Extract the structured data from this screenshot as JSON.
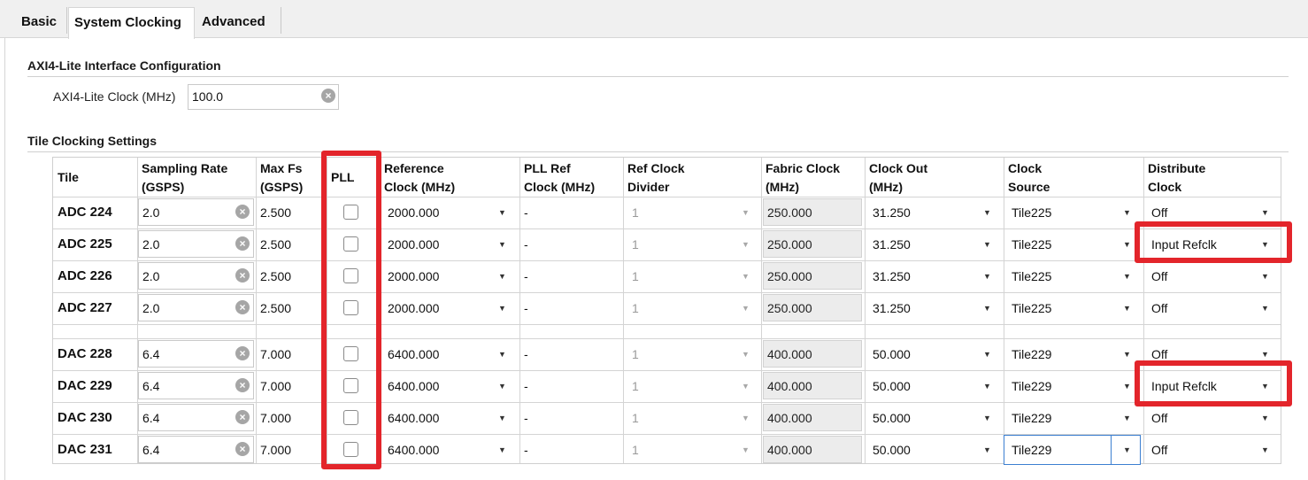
{
  "tabs": [
    {
      "label": "Basic",
      "active": false
    },
    {
      "label": "System Clocking",
      "active": true
    },
    {
      "label": "Advanced",
      "active": false
    }
  ],
  "axi": {
    "section_title": "AXI4-Lite Interface Configuration",
    "clock_label": "AXI4-Lite Clock (MHz)",
    "clock_value": "100.0"
  },
  "tile_section_title": "Tile Clocking Settings",
  "columns": [
    {
      "line1": "Tile",
      "line2": ""
    },
    {
      "line1": "Sampling Rate",
      "line2": "(GSPS)"
    },
    {
      "line1": "Max Fs",
      "line2": "(GSPS)"
    },
    {
      "line1": "PLL",
      "line2": ""
    },
    {
      "line1": "Reference",
      "line2": "Clock (MHz)"
    },
    {
      "line1": "PLL Ref",
      "line2": "Clock (MHz)"
    },
    {
      "line1": "Ref Clock",
      "line2": "Divider"
    },
    {
      "line1": "Fabric Clock",
      "line2": "(MHz)"
    },
    {
      "line1": "Clock Out",
      "line2": "(MHz)"
    },
    {
      "line1": "Clock",
      "line2": "Source"
    },
    {
      "line1": "Distribute",
      "line2": "Clock"
    }
  ],
  "rows": [
    {
      "tile": "ADC 224",
      "sampling": "2.0",
      "maxfs": "2.500",
      "pll": false,
      "ref": "2000.000",
      "pllref": "-",
      "div": "1",
      "fabric": "250.000",
      "clkout": "31.250",
      "source": "Tile225",
      "distribute": "Off"
    },
    {
      "tile": "ADC 225",
      "sampling": "2.0",
      "maxfs": "2.500",
      "pll": false,
      "ref": "2000.000",
      "pllref": "-",
      "div": "1",
      "fabric": "250.000",
      "clkout": "31.250",
      "source": "Tile225",
      "distribute": "Input Refclk"
    },
    {
      "tile": "ADC 226",
      "sampling": "2.0",
      "maxfs": "2.500",
      "pll": false,
      "ref": "2000.000",
      "pllref": "-",
      "div": "1",
      "fabric": "250.000",
      "clkout": "31.250",
      "source": "Tile225",
      "distribute": "Off"
    },
    {
      "tile": "ADC 227",
      "sampling": "2.0",
      "maxfs": "2.500",
      "pll": false,
      "ref": "2000.000",
      "pllref": "-",
      "div": "1",
      "fabric": "250.000",
      "clkout": "31.250",
      "source": "Tile225",
      "distribute": "Off"
    },
    {
      "tile": "DAC 228",
      "sampling": "6.4",
      "maxfs": "7.000",
      "pll": false,
      "ref": "6400.000",
      "pllref": "-",
      "div": "1",
      "fabric": "400.000",
      "clkout": "50.000",
      "source": "Tile229",
      "distribute": "Off"
    },
    {
      "tile": "DAC 229",
      "sampling": "6.4",
      "maxfs": "7.000",
      "pll": false,
      "ref": "6400.000",
      "pllref": "-",
      "div": "1",
      "fabric": "400.000",
      "clkout": "50.000",
      "source": "Tile229",
      "distribute": "Input Refclk"
    },
    {
      "tile": "DAC 230",
      "sampling": "6.4",
      "maxfs": "7.000",
      "pll": false,
      "ref": "6400.000",
      "pllref": "-",
      "div": "1",
      "fabric": "400.000",
      "clkout": "50.000",
      "source": "Tile229",
      "distribute": "Off"
    },
    {
      "tile": "DAC 231",
      "sampling": "6.4",
      "maxfs": "7.000",
      "pll": false,
      "ref": "6400.000",
      "pllref": "-",
      "div": "1",
      "fabric": "400.000",
      "clkout": "50.000",
      "source": "Tile229",
      "distribute": "Off"
    }
  ],
  "icons": {
    "clear": "clear-circle-icon",
    "dropdown": "chevron-down-icon"
  },
  "colors": {
    "highlight": "#e3252b",
    "focus": "#3c7fd1"
  }
}
